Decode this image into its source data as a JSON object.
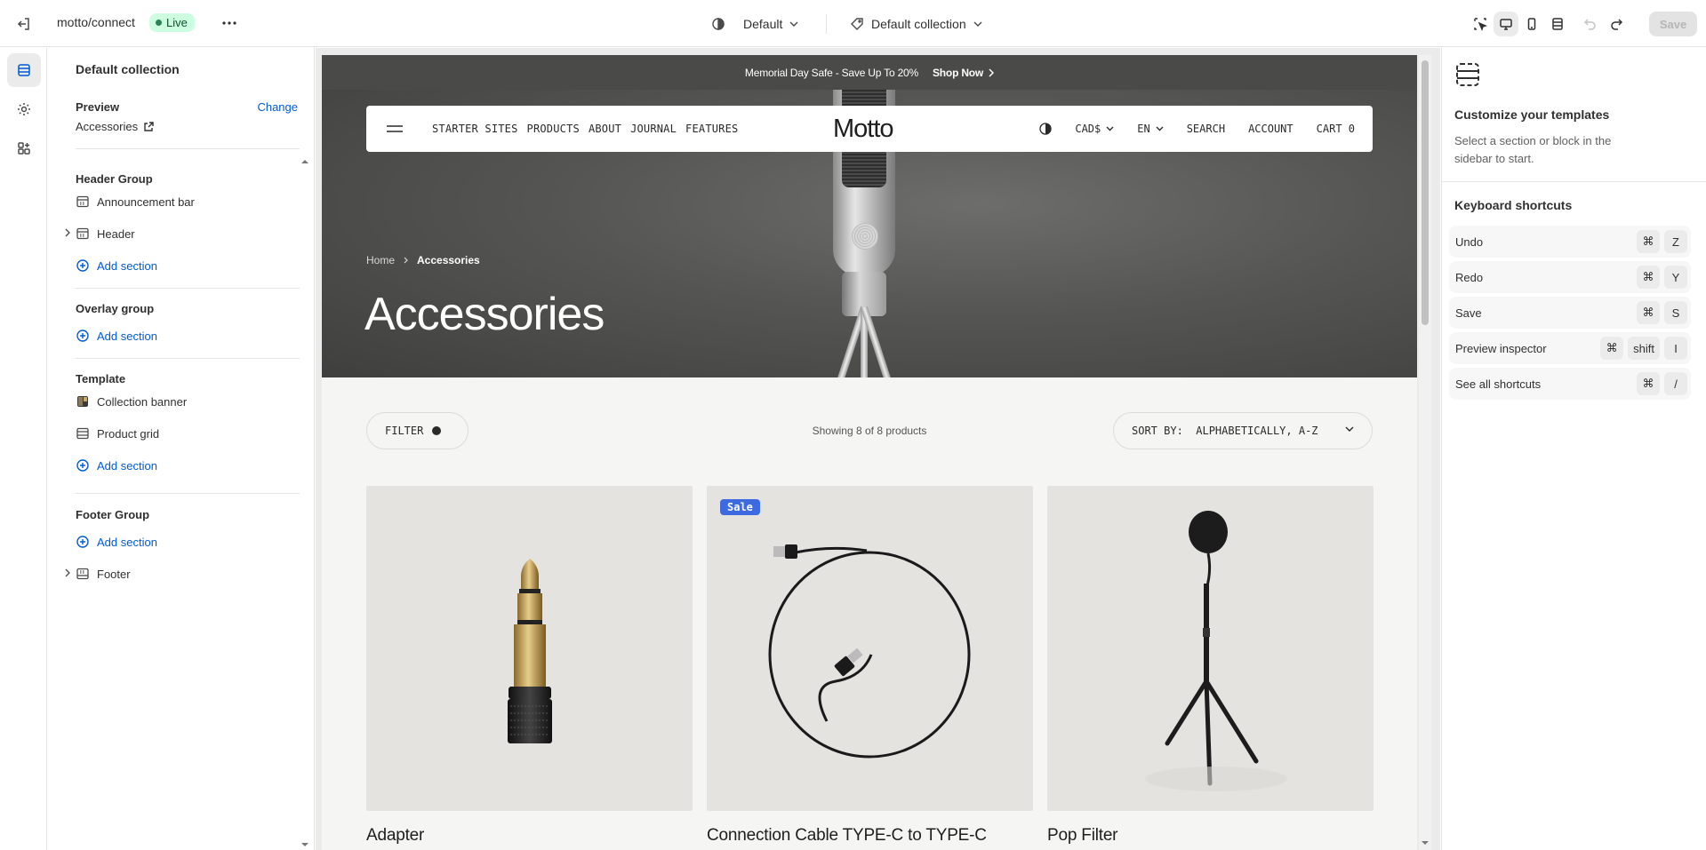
{
  "topbar": {
    "store_name": "motto/connect",
    "status_badge": "Live",
    "theme_label": "Default",
    "template_label": "Default collection",
    "save_label": "Save"
  },
  "sidebar": {
    "title": "Default collection",
    "preview_label": "Preview",
    "change_label": "Change",
    "preview_value": "Accessories",
    "groups": [
      {
        "title": "Header Group",
        "items": [
          "Announcement bar",
          "Header"
        ],
        "add": "Add section"
      },
      {
        "title": "Overlay group",
        "items": [],
        "add": "Add section"
      },
      {
        "title": "Template",
        "items": [
          "Collection banner",
          "Product grid"
        ],
        "add": "Add section"
      },
      {
        "title": "Footer Group",
        "add": "Add section",
        "items": [
          "Footer"
        ]
      }
    ]
  },
  "preview": {
    "announcement": "Memorial Day Safe - Save Up To 20%",
    "announcement_cta": "Shop Now",
    "nav": [
      "STARTER SITES",
      "PRODUCTS",
      "ABOUT",
      "JOURNAL",
      "FEATURES"
    ],
    "logo": "Motto",
    "currency": "CAD$",
    "language": "EN",
    "search": "SEARCH",
    "account": "ACCOUNT",
    "cart": "CART 0",
    "breadcrumb_home": "Home",
    "breadcrumb_current": "Accessories",
    "hero_title": "Accessories",
    "filter_label": "FILTER",
    "showing": "Showing 8 of 8 products",
    "sort_label": "SORT BY:  ALPHABETICALLY, A-Z",
    "products": [
      {
        "name": "Adapter",
        "badge": ""
      },
      {
        "name": "Connection Cable TYPE-C to TYPE-C",
        "badge": "Sale"
      },
      {
        "name": "Pop Filter",
        "badge": ""
      }
    ]
  },
  "right_panel": {
    "title": "Customize your templates",
    "description": "Select a section or block in the sidebar to start.",
    "shortcuts_title": "Keyboard shortcuts",
    "shortcuts": [
      {
        "label": "Undo",
        "keys": [
          "⌘",
          "Z"
        ]
      },
      {
        "label": "Redo",
        "keys": [
          "⌘",
          "Y"
        ]
      },
      {
        "label": "Save",
        "keys": [
          "⌘",
          "S"
        ]
      },
      {
        "label": "Preview inspector",
        "keys": [
          "⌘",
          "shift",
          "I"
        ]
      },
      {
        "label": "See all shortcuts",
        "keys": [
          "⌘",
          "/"
        ]
      }
    ]
  },
  "colors": {
    "accent": "#005bd3",
    "live_badge_bg": "#cdfee1",
    "sale_badge": "#3d6ae0",
    "announcement_bg": "#4a4a48"
  }
}
